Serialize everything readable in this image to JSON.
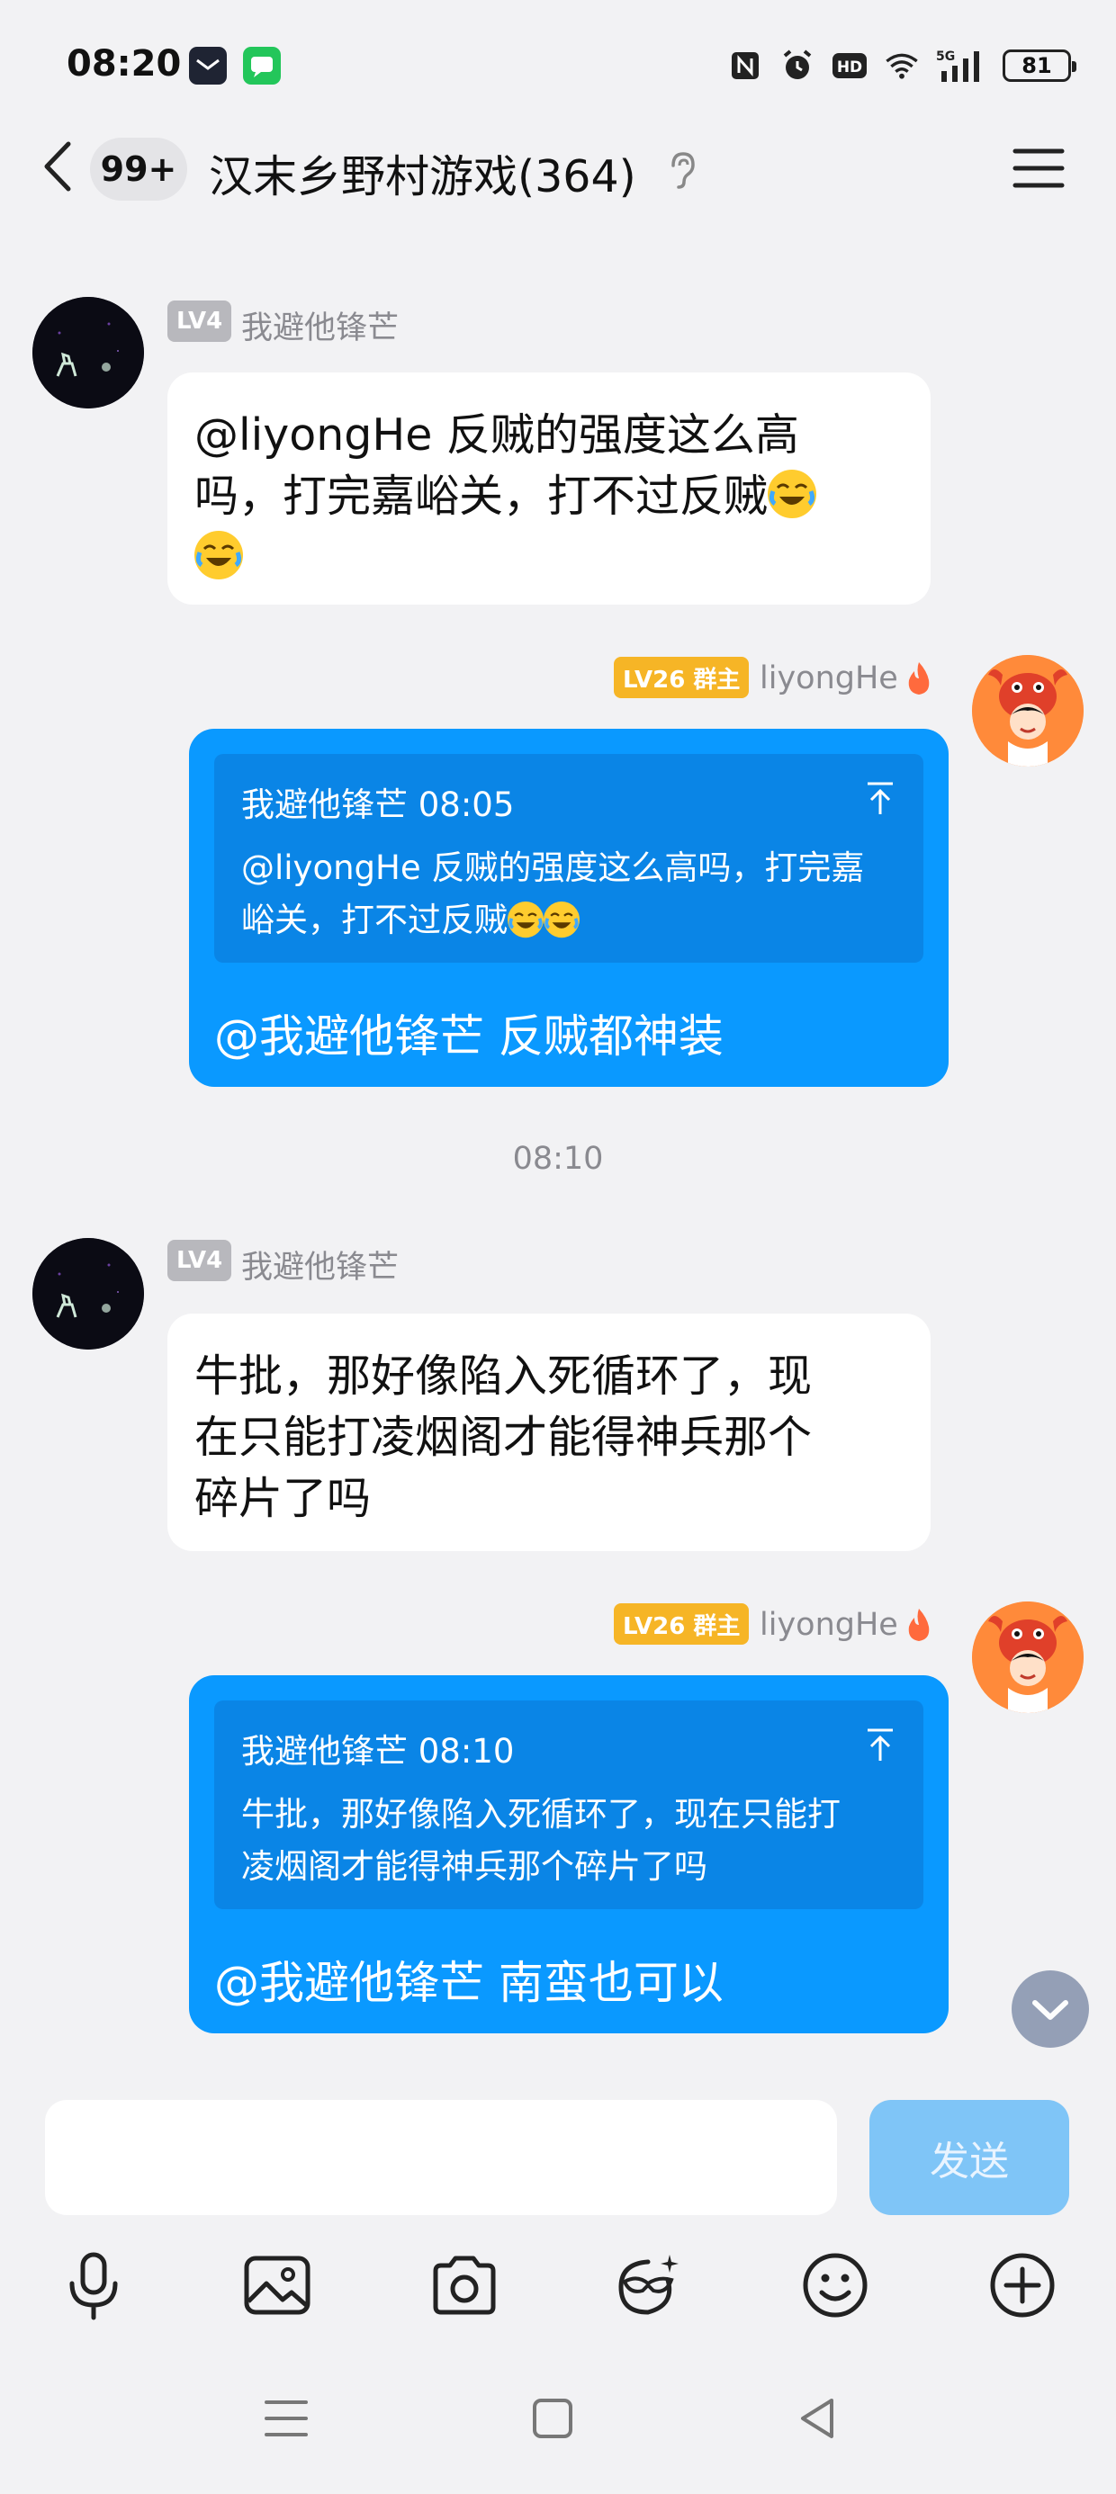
{
  "status_bar": {
    "time": "08:20",
    "battery": "81",
    "icons": [
      "mail-app-icon",
      "message-app-icon",
      "nfc-icon",
      "alarm-icon",
      "hd-icon",
      "wifi-icon",
      "5g-signal-icon",
      "battery-icon"
    ]
  },
  "header": {
    "unread_count": "99+",
    "title": "汉末乡野村游戏(364)",
    "icons": [
      "back-icon",
      "ear-icon",
      "menu-icon"
    ]
  },
  "messages": [
    {
      "sender_level": "LV4",
      "sender_name": "我避他锋芒",
      "line1": "@liyongHe 反贼的强度这么高",
      "line2": "吗，打完嘉峪关，打不过反贼",
      "emoji": "laughing-tears-emoji"
    },
    {
      "sender_level": "LV26 群主",
      "sender_name": "liyongHe",
      "quote_author_time": "我避他锋芒 08:05",
      "quote_line1": "@liyongHe 反贼的强度这么高吗，打完嘉",
      "quote_line2": "峪关，打不过反贼",
      "reply": "@我避他锋芒 反贼都神装"
    },
    {
      "separator_time": "08:10"
    },
    {
      "sender_level": "LV4",
      "sender_name": "我避他锋芒",
      "line1": "牛批，那好像陷入死循环了，现",
      "line2": "在只能打凌烟阁才能得神兵那个",
      "line3": "碎片了吗"
    },
    {
      "sender_level": "LV26 群主",
      "sender_name": "liyongHe",
      "quote_author_time": "我避他锋芒 08:10",
      "quote_line1": "牛批，那好像陷入死循环了，现在只能打",
      "quote_line2": "凌烟阁才能得神兵那个碎片了吗",
      "reply": "@我避他锋芒 南蛮也可以"
    }
  ],
  "input": {
    "placeholder": "",
    "send_label": "发送"
  },
  "toolbar": [
    "microphone-icon",
    "image-icon",
    "camera-icon",
    "sticker-icon",
    "emoji-icon",
    "plus-icon"
  ],
  "nav": [
    "menu-nav-icon",
    "home-nav-icon",
    "back-nav-icon"
  ],
  "colors": {
    "bubble_blue": "#0a99ff",
    "quote_blue": "#0a85e6",
    "level_gold": "#f6b526",
    "level_gray": "#b8b8bd",
    "send_button": "#7fc5f7"
  }
}
